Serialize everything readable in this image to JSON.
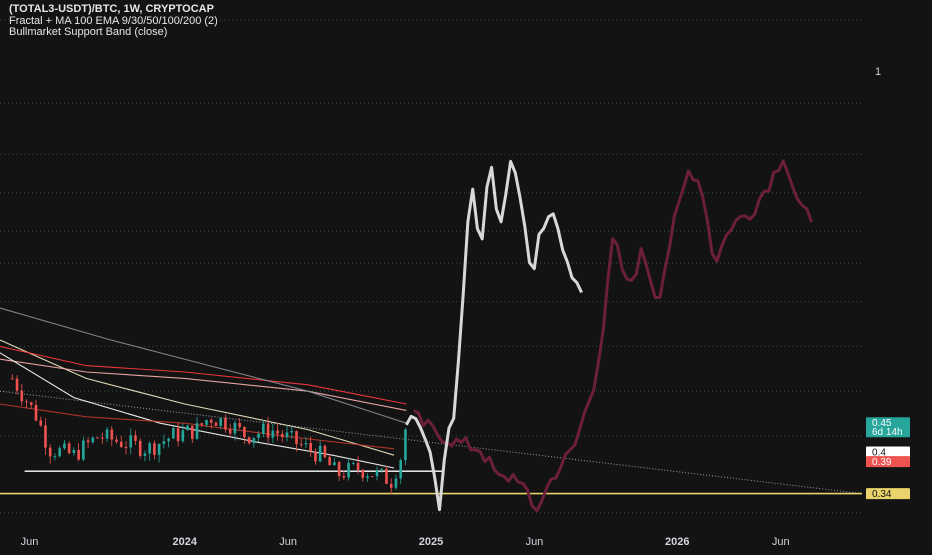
{
  "legend": {
    "title": "(TOTAL3-USDT)/BTC, 1W, CRYPTOCAP",
    "line2": "Fractal + MA 100 EMA 9/30/50/100/200 (2)",
    "line3": "Bullmarket Support Band (close)"
  },
  "colors": {
    "background": "#131313",
    "up": "#26a69a",
    "down": "#ef5350",
    "fractal_past": "#d8d8d8",
    "fractal_future": "#6b1f3a",
    "support_yellow": "#e8d46a",
    "grid": "#2f5a50"
  },
  "chart_data": {
    "type": "candlestick",
    "x_ticks": [
      "Jun",
      "2024",
      "Jun",
      "2025",
      "Jun",
      "2026",
      "Jun"
    ],
    "price_labels": [
      {
        "text": "0.45",
        "sub": "6d 14h",
        "value": 0.45,
        "color": "#26a69a"
      },
      {
        "text": "0.4",
        "value": 0.405,
        "color": "#ffffff"
      },
      {
        "text": "0.39",
        "value": 0.39,
        "color": "#ef5350"
      },
      {
        "text": "0.34",
        "value": 0.34,
        "color": "#e8d46a"
      }
    ],
    "right_axis_label": "1",
    "right_axis_label_value": 1.0,
    "ylim": [
      0.28,
      1.08
    ],
    "xlim": [
      2023.25,
      2026.75
    ],
    "horizontal_support": 0.34,
    "candles_range": [
      2023.3,
      2024.9
    ],
    "candle_close_path": [
      [
        2023.3,
        0.52
      ],
      [
        2023.4,
        0.46
      ],
      [
        2023.45,
        0.41
      ],
      [
        2023.55,
        0.4
      ],
      [
        2023.65,
        0.43
      ],
      [
        2023.75,
        0.42
      ],
      [
        2023.85,
        0.41
      ],
      [
        2023.95,
        0.43
      ],
      [
        2024.05,
        0.44
      ],
      [
        2024.1,
        0.46
      ],
      [
        2024.18,
        0.45
      ],
      [
        2024.25,
        0.43
      ],
      [
        2024.35,
        0.44
      ],
      [
        2024.45,
        0.42
      ],
      [
        2024.55,
        0.4
      ],
      [
        2024.62,
        0.37
      ],
      [
        2024.7,
        0.38
      ],
      [
        2024.78,
        0.37
      ],
      [
        2024.84,
        0.36
      ],
      [
        2024.88,
        0.4
      ],
      [
        2024.9,
        0.45
      ]
    ],
    "fractal_past": [
      [
        2024.9,
        0.46
      ],
      [
        2024.95,
        0.44
      ],
      [
        2025.0,
        0.4
      ],
      [
        2025.03,
        0.31
      ],
      [
        2025.06,
        0.42
      ],
      [
        2025.1,
        0.48
      ],
      [
        2025.13,
        0.65
      ],
      [
        2025.16,
        0.83
      ],
      [
        2025.2,
        0.72
      ],
      [
        2025.24,
        0.86
      ],
      [
        2025.28,
        0.76
      ],
      [
        2025.33,
        0.88
      ],
      [
        2025.37,
        0.79
      ],
      [
        2025.41,
        0.67
      ],
      [
        2025.45,
        0.76
      ],
      [
        2025.5,
        0.79
      ],
      [
        2025.54,
        0.72
      ],
      [
        2025.58,
        0.68
      ],
      [
        2025.62,
        0.66
      ]
    ],
    "fractal_future": [
      [
        2024.93,
        0.46
      ],
      [
        2025.0,
        0.44
      ],
      [
        2025.1,
        0.42
      ],
      [
        2025.2,
        0.41
      ],
      [
        2025.28,
        0.36
      ],
      [
        2025.35,
        0.37
      ],
      [
        2025.42,
        0.31
      ],
      [
        2025.5,
        0.37
      ],
      [
        2025.58,
        0.41
      ],
      [
        2025.66,
        0.51
      ],
      [
        2025.7,
        0.6
      ],
      [
        2025.74,
        0.74
      ],
      [
        2025.8,
        0.66
      ],
      [
        2025.86,
        0.72
      ],
      [
        2025.92,
        0.64
      ],
      [
        2025.98,
        0.75
      ],
      [
        2026.05,
        0.85
      ],
      [
        2026.1,
        0.82
      ],
      [
        2026.15,
        0.7
      ],
      [
        2026.22,
        0.76
      ],
      [
        2026.3,
        0.78
      ],
      [
        2026.38,
        0.83
      ],
      [
        2026.43,
        0.87
      ],
      [
        2026.5,
        0.78
      ],
      [
        2026.56,
        0.77
      ]
    ],
    "moving_averages": [
      {
        "color": "#f5f0c8",
        "points": [
          [
            2023.25,
            0.58
          ],
          [
            2023.6,
            0.52
          ],
          [
            2024.0,
            0.48
          ],
          [
            2024.5,
            0.44
          ],
          [
            2024.85,
            0.4
          ]
        ]
      },
      {
        "color": "#ff3b3b",
        "points": [
          [
            2023.25,
            0.57
          ],
          [
            2023.6,
            0.54
          ],
          [
            2024.0,
            0.53
          ],
          [
            2024.5,
            0.51
          ],
          [
            2024.9,
            0.48
          ]
        ]
      },
      {
        "color": "#ffb3b3",
        "points": [
          [
            2023.25,
            0.55
          ],
          [
            2023.6,
            0.53
          ],
          [
            2024.0,
            0.52
          ],
          [
            2024.5,
            0.5
          ],
          [
            2024.9,
            0.47
          ]
        ]
      },
      {
        "color": "#ffffff",
        "points": [
          [
            2023.25,
            0.56
          ],
          [
            2023.55,
            0.49
          ],
          [
            2023.9,
            0.45
          ],
          [
            2024.3,
            0.42
          ],
          [
            2024.6,
            0.4
          ],
          [
            2024.85,
            0.38
          ]
        ]
      },
      {
        "color": "#8a8f99",
        "points": [
          [
            2023.25,
            0.63
          ],
          [
            2023.7,
            0.58
          ],
          [
            2024.1,
            0.54
          ],
          [
            2024.5,
            0.5
          ],
          [
            2024.9,
            0.45
          ]
        ]
      },
      {
        "color": "#c0392b",
        "points": [
          [
            2023.25,
            0.48
          ],
          [
            2023.6,
            0.46
          ],
          [
            2024.0,
            0.45
          ],
          [
            2024.4,
            0.43
          ],
          [
            2024.85,
            0.41
          ]
        ]
      }
    ],
    "dotted_trend": [
      [
        2023.25,
        0.5
      ],
      [
        2026.75,
        0.34
      ]
    ],
    "white_support_line": {
      "from": 2023.35,
      "to": 2025.05,
      "value": 0.375
    },
    "gridlines": [
      1.08,
      0.95,
      0.87,
      0.81,
      0.75,
      0.7,
      0.64,
      0.57,
      0.5,
      0.43,
      0.31
    ]
  }
}
